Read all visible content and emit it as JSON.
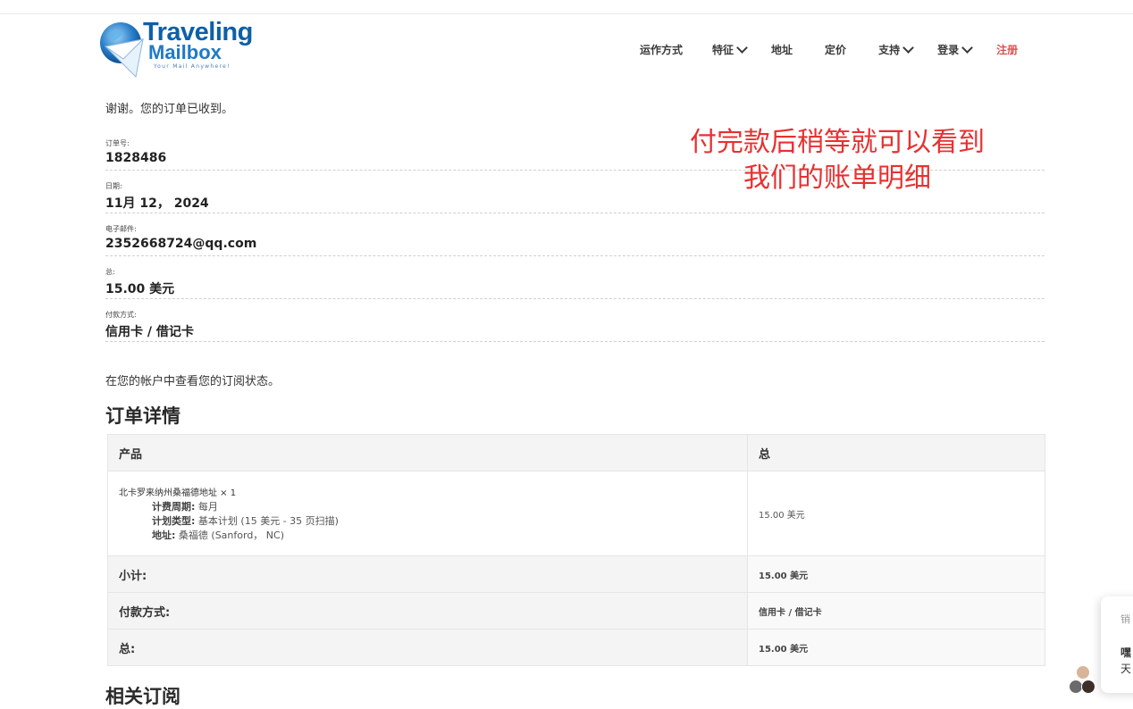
{
  "brand": {
    "name_top": "Traveling",
    "name_bottom": "Mailbox",
    "tagline": "Your Mail Anywhere!"
  },
  "nav": {
    "how_it_works": "运作方式",
    "features": "特征",
    "addresses": "地址",
    "pricing": "定价",
    "support": "支持",
    "login": "登录",
    "signup": "注册"
  },
  "thanks_text": "谢谢。您的订单已收到。",
  "overview": [
    {
      "label": "订单号:",
      "value": "1828486"
    },
    {
      "label": "日期:",
      "value": "11月 12， 2024"
    },
    {
      "label": "电子邮件:",
      "value": "2352668724@qq.com"
    },
    {
      "label": "总:",
      "value": "15.00 美元"
    },
    {
      "label": "付款方式:",
      "value": "信用卡 / 借记卡"
    }
  ],
  "annotation": {
    "line1": "付完款后稍等就可以看到",
    "line2": "我们的账单明细"
  },
  "view_status_text": "在您的帐户中查看您的订阅状态。",
  "order_details": {
    "heading": "订单详情",
    "col_product": "产品",
    "col_total": "总",
    "item": {
      "name": "北卡罗来纳州桑福德地址 × 1",
      "billing_label": "计费周期:",
      "billing_value": "每月",
      "plan_label": "计划类型:",
      "plan_value": "基本计划 (15 美元 - 35 页扫描)",
      "address_label": "地址:",
      "address_value": "桑福德 (Sanford， NC)",
      "amount": "15.00 美元"
    },
    "footer": [
      {
        "label": "小计:",
        "value": "15.00 美元"
      },
      {
        "label": "付款方式:",
        "value": "信用卡 / 借记卡"
      },
      {
        "label": "总:",
        "value": "15.00 美元"
      }
    ]
  },
  "related_heading": "相关订阅",
  "chat": {
    "line1": "销",
    "line2": "嘿",
    "line3": "天"
  },
  "colors": {
    "brand_blue": "#0d5fa8",
    "annotation_red": "#e83030",
    "signup_red": "#d9534f"
  }
}
